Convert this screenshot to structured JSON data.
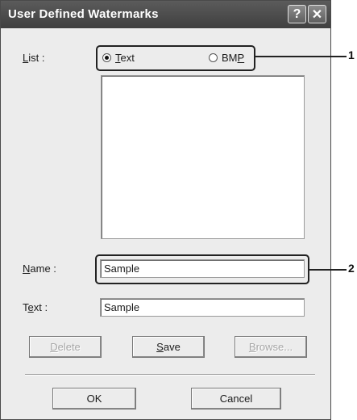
{
  "dialog": {
    "title": "User Defined Watermarks",
    "help_icon": "?",
    "close_icon": "✕"
  },
  "list": {
    "label_u": "L",
    "label_rest": "ist :",
    "radio_text_u": "T",
    "radio_text_rest": "ext",
    "radio_bmp_main": "BM",
    "radio_bmp_u": "P",
    "selected": "Text"
  },
  "name": {
    "label_u": "N",
    "label_rest": "ame :",
    "value": "Sample"
  },
  "text": {
    "label_pre": "T",
    "label_u": "e",
    "label_rest": "xt :",
    "value": "Sample"
  },
  "buttons": {
    "delete_u": "D",
    "delete_rest": "elete",
    "save_u": "S",
    "save_rest": "ave",
    "browse_u": "B",
    "browse_rest": "rowse...",
    "ok": "OK",
    "cancel": "Cancel"
  },
  "callouts": {
    "one": "1",
    "two": "2"
  },
  "icons": {
    "help": "help-icon",
    "close": "close-icon",
    "radio_selected": "radio-selected-icon",
    "radio_unselected": "radio-unselected-icon"
  }
}
